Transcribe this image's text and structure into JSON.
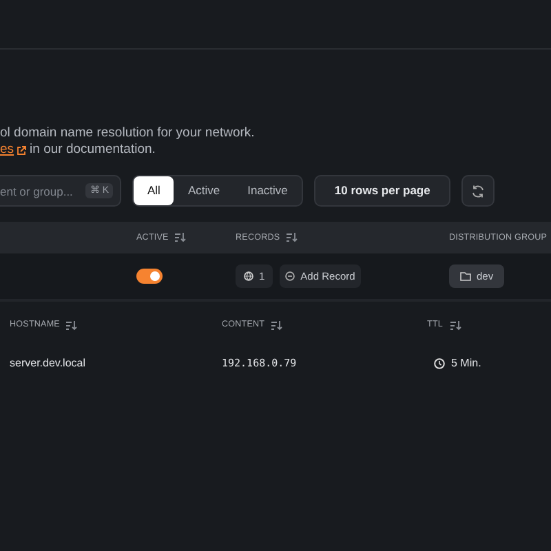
{
  "description": {
    "line1": "ol domain name resolution for your network.",
    "link": "es",
    "line2_rest": "in our documentation."
  },
  "search": {
    "placeholder": "ent or group...",
    "shortcut": "⌘ K"
  },
  "filters": [
    {
      "label": "All",
      "selected": true
    },
    {
      "label": "Active",
      "selected": false
    },
    {
      "label": "Inactive",
      "selected": false
    }
  ],
  "rows_per_page": "10 rows per page",
  "table": {
    "columns": [
      "ACTIVE",
      "RECORDS",
      "DISTRIBUTION GROUP"
    ],
    "rows": [
      {
        "active": true,
        "records_count": "1",
        "add_record": "Add Record",
        "groups": [
          "dev"
        ],
        "records": {
          "columns": [
            "HOSTNAME",
            "CONTENT",
            "TTL"
          ],
          "rows": [
            {
              "hostname": "server.dev.local",
              "content": "192.168.0.79",
              "ttl": "5 Min."
            }
          ]
        }
      }
    ]
  }
}
